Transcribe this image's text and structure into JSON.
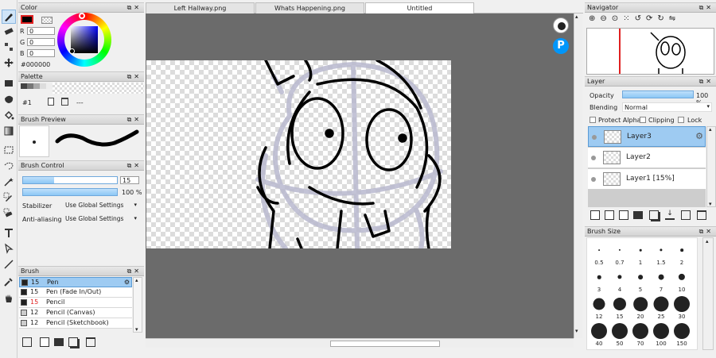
{
  "tabs": [
    "Left Hallway.png",
    "Whats Happening.png",
    "Untitled"
  ],
  "color": {
    "title": "Color",
    "r_label": "R",
    "g_label": "G",
    "b_label": "B",
    "r": "0",
    "g": "0",
    "b": "0",
    "hex": "#000000",
    "primary_color": "#000000",
    "accent_red": "#e02020"
  },
  "palette": {
    "title": "Palette",
    "index_label": "#1",
    "more": "---"
  },
  "brush_preview": {
    "title": "Brush Preview"
  },
  "brush_control": {
    "title": "Brush Control",
    "size_value": "15",
    "opacity_value": "100 %",
    "stabilizer_label": "Stabilizer",
    "stabilizer_value": "Use Global Settings",
    "antialias_label": "Anti-aliasing",
    "antialias_value": "Use Global Settings",
    "size_fraction": 0.33,
    "opacity_fraction": 1.0
  },
  "brush": {
    "title": "Brush",
    "items": [
      {
        "size": "15",
        "name": "Pen",
        "selected": true
      },
      {
        "size": "15",
        "name": "Pen (Fade In/Out)"
      },
      {
        "size": "15",
        "name": "Pencil"
      },
      {
        "size": "12",
        "name": "Pencil (Canvas)"
      },
      {
        "size": "12",
        "name": "Pencil (Sketchbook)"
      }
    ]
  },
  "navigator": {
    "title": "Navigator"
  },
  "layer": {
    "title": "Layer",
    "opacity_label": "Opacity",
    "opacity_value": "100 %",
    "blending_label": "Blending",
    "blending_value": "Normal",
    "protect_alpha": "Protect Alpha",
    "clipping": "Clipping",
    "lock": "Lock",
    "layers": [
      {
        "name": "Layer3",
        "selected": true
      },
      {
        "name": "Layer2"
      },
      {
        "name": "Layer1 [15%]"
      }
    ]
  },
  "brush_size": {
    "title": "Brush Size",
    "sizes": [
      "0.5",
      "0.7",
      "1",
      "1.5",
      "2",
      "3",
      "4",
      "5",
      "7",
      "10",
      "12",
      "15",
      "20",
      "25",
      "30",
      "40",
      "50",
      "70",
      "100",
      "150"
    ]
  }
}
